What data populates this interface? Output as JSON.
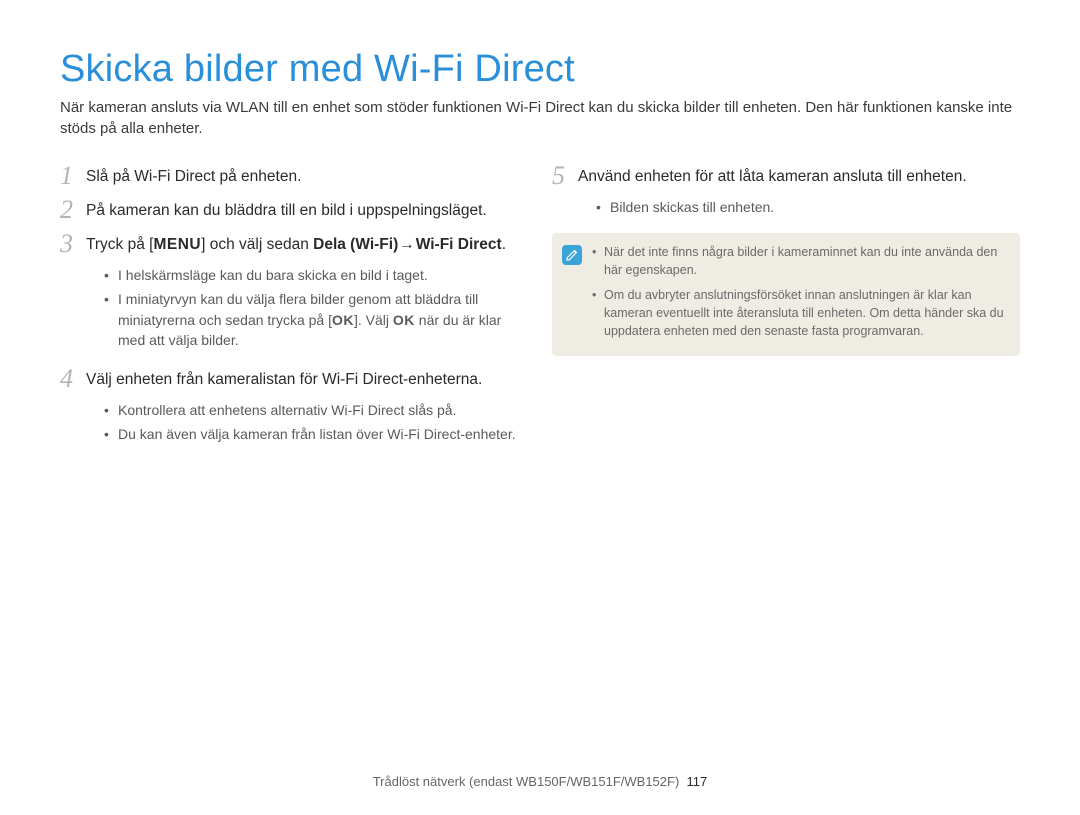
{
  "title": "Skicka bilder med Wi-Fi Direct",
  "intro": "När kameran ansluts via WLAN till en enhet som stöder funktionen Wi-Fi Direct kan du skicka bilder till enheten. Den här funktionen kanske inte stöds på alla enheter.",
  "left": {
    "step1": {
      "num": "1",
      "text": "Slå på Wi-Fi Direct på enheten."
    },
    "step2": {
      "num": "2",
      "text": "På kameran kan du bläddra till en bild i uppspelningsläget."
    },
    "step3": {
      "num": "3",
      "pre": "Tryck på [",
      "menu": "MENU",
      "mid": "] och välj sedan ",
      "bold1": "Dela (Wi-Fi)",
      "arrow": " → ",
      "bold2": "Wi-Fi Direct",
      "post": "."
    },
    "step3_subs": {
      "a": "I helskärmsläge kan du bara skicka en bild i taget.",
      "b_pre": "I miniatyrvyn kan du välja flera bilder genom att bläddra till miniatyrerna och sedan trycka på [",
      "b_ok1": "OK",
      "b_mid": "]. Välj ",
      "b_ok2": "OK",
      "b_post": " när du är klar med att välja bilder."
    },
    "step4": {
      "num": "4",
      "text": "Välj enheten från kameralistan för Wi-Fi Direct-enheterna."
    },
    "step4_subs": {
      "a": "Kontrollera att enhetens alternativ Wi-Fi Direct slås på.",
      "b": "Du kan även välja kameran från listan över Wi-Fi Direct-enheter."
    }
  },
  "right": {
    "step5": {
      "num": "5",
      "text": "Använd enheten för att låta kameran ansluta till enheten."
    },
    "step5_subs": {
      "a": "Bilden skickas till enheten."
    },
    "note_icon_glyph": "✎",
    "note": {
      "a": "När det inte finns några bilder i kameraminnet kan du inte använda den här egenskapen.",
      "b": "Om du avbryter anslutningsförsöket innan anslutningen är klar kan kameran eventuellt inte återansluta till enheten. Om detta händer ska du uppdatera enheten med den senaste fasta programvaran."
    }
  },
  "footer": {
    "text": "Trådlöst nätverk (endast WB150F/WB151F/WB152F)",
    "page": "117"
  }
}
